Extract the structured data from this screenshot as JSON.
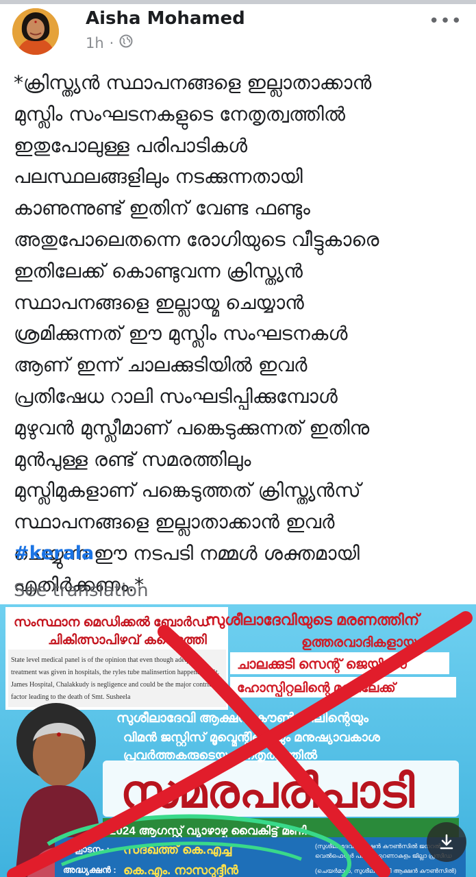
{
  "post": {
    "author": "Aisha Mohamed",
    "time": "1h",
    "separator": "·",
    "privacy_icon": "globe-icon",
    "more_label": "•••",
    "lines": [
      "*ക്രിസ്ത്യൻ സ്ഥാപനങ്ങളെ ഇല്ലാതാക്കാൻ",
      "മുസ്ലിം സംഘടനകളുടെ നേതൃത്വത്തിൽ",
      "ഇതുപോലുള്ള പരിപാടികൾ",
      "പലസ്ഥലങ്ങളിലും നടക്കുന്നതായി",
      "കാണുന്നുണ്ട് ഇതിന് വേണ്ട ഫണ്ടും",
      "അതുപോലെതന്നെ രോഗിയുടെ വീട്ടുകാരെ",
      "ഇതിലേക്ക് കൊണ്ടുവന്ന ക്രിസ്ത്യൻ",
      "സ്ഥാപനങ്ങളെ ഇല്ലായ്മ ചെയ്യാൻ",
      "ശ്രമിക്കുന്നത് ഈ മുസ്ലിം സംഘടനകൾ",
      "ആണ് ഇന്ന് ചാലക്കുടിയിൽ ഇവർ",
      "പ്രതിഷേധ റാലി സംഘടിപ്പിക്കുമ്പോൾ",
      "മുഴുവൻ മുസ്ലീമാണ് പങ്കെടുക്കുന്നത് ഇതിനു",
      "മുൻപുള്ള രണ്ട് സമരത്തിലും",
      "മുസ്ലിമുകളാണ് പങ്കെടുത്തത് ക്രിസ്ത്യൻസ്",
      "സ്ഥാപനങ്ങളെ ഇല്ലാതാക്കാൻ ഇവർ",
      "ചെയ്യുന്ന ഈ നടപടി നമ്മൾ ശക്തമായി",
      "എതിർക്കണം.*"
    ],
    "hashtag": "#kerala",
    "see_translation": "See translation"
  },
  "image": {
    "box_title_1": "സംസ്ഥാന മെഡിക്കൽ ബോർഡ്",
    "box_title_2": "ചികിത്സാപിഴവ് കണ്ടെത്തി",
    "report_lines": [
      "State level medical panel is of the opinion that even though adequate",
      "treatment was given in hospitals, the ryles tube malinsertion happened at St.",
      "James Hospital, Chalakkudy is negligence and could be the major contributory",
      "factor leading to the death of Smt. Susheela"
    ],
    "headline_lines": [
      "സുശീലാദേവിയുടെ മരണത്തിന്",
      "ഉത്തരവാദികളായ",
      "ചാലക്കുടി സെന്റ് ജെയിംസ്",
      "ഹോസ്പിറ്റലിന്റെ മുന്നിലേക്ക്"
    ],
    "organizer_lines": [
      "സുശീലാദേവി ആക്ഷൻ കൗൺസിലിന്റെയും",
      "വിമൻ ജസ്റ്റിസ് മൂവ്മെന്റിന്റെയും മനുഷ്യാവകാശ",
      "പ്രവർത്തകരുടെയും നേതൃത്വത്തിൽ"
    ],
    "event_title": "സമരപരിപാടി",
    "date_line": "2024 ആഗസ്റ്റ് വ്യാഴാഴ്ച വൈകിട്ട് മണി",
    "inaug_label": "ഉദ്ഘാടനം :",
    "inaug_name": "സദഖത്ത് കെ.എച്ച്",
    "inaug_note_1": "(സുശീലാദേവി ആക്ഷൻ കൗൺസിൽ ജനറൽ",
    "inaug_note_2": "വെൽഫെയർ പാർട്ടി എറണാകുളം ജില്ലാ പ്രസിഡ",
    "chair_label": "അദ്ധ്യക്ഷൻ :",
    "chair_name": "കെ.എം. നാസറുദ്ദീൻ",
    "chair_note": "(ചെയർമാൻ, സുശീലാദേവി ആക്ഷൻ കൗൺസിൽ)",
    "download_icon": "download-icon",
    "colors": {
      "background": "#5ec5ea",
      "cross": "#e11d2b",
      "headline": "#d01a25",
      "event_title": "#b8141e",
      "highlight": "#39d98a"
    }
  }
}
